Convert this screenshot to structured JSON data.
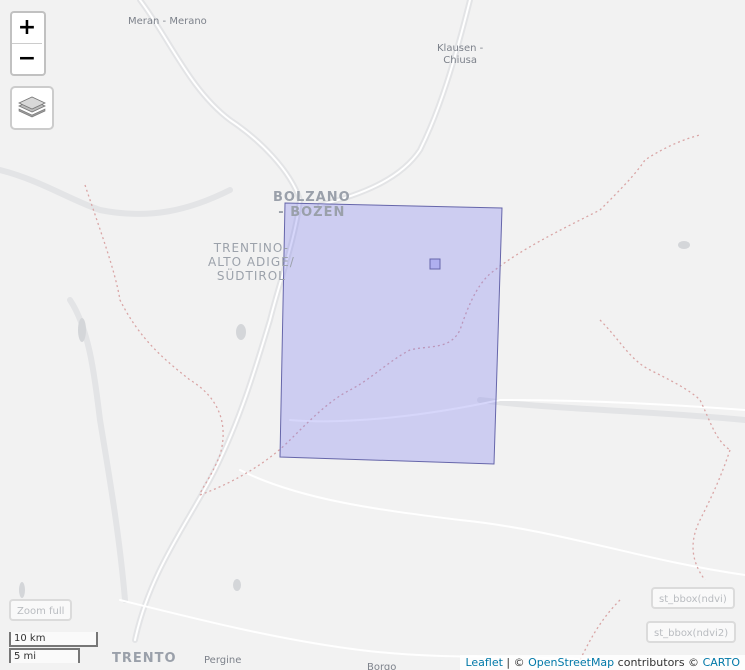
{
  "map": {
    "places": [
      {
        "name": "Meran - Merano",
        "kind": "town"
      },
      {
        "name": "Klausen -\nChiusa",
        "kind": "town"
      },
      {
        "name": "BOLZANO\n- BOZEN",
        "kind": "city"
      },
      {
        "name": "TRENTINO-\nALTO ADIGE/\nSÜDTIROL",
        "kind": "region"
      },
      {
        "name": "TRENTO",
        "kind": "city"
      },
      {
        "name": "Pergine",
        "kind": "town"
      },
      {
        "name": "Borgo",
        "kind": "town"
      }
    ],
    "overlay_fill": "#7777ee",
    "overlay_stroke": "#6666aa"
  },
  "controls": {
    "zoom_in_label": "+",
    "zoom_out_label": "−",
    "zoom_full_label": "Zoom full",
    "layer_ndvi_label": "st_bbox(ndvi)",
    "layer_ndvi2_label": "st_bbox(ndvi2)"
  },
  "scale": {
    "metric": "10 km",
    "imperial": "5 mi"
  },
  "attribution": {
    "leaflet": "Leaflet",
    "separator": " | © ",
    "osm": "OpenStreetMap",
    "contributors": " contributors © ",
    "carto": "CARTO"
  }
}
